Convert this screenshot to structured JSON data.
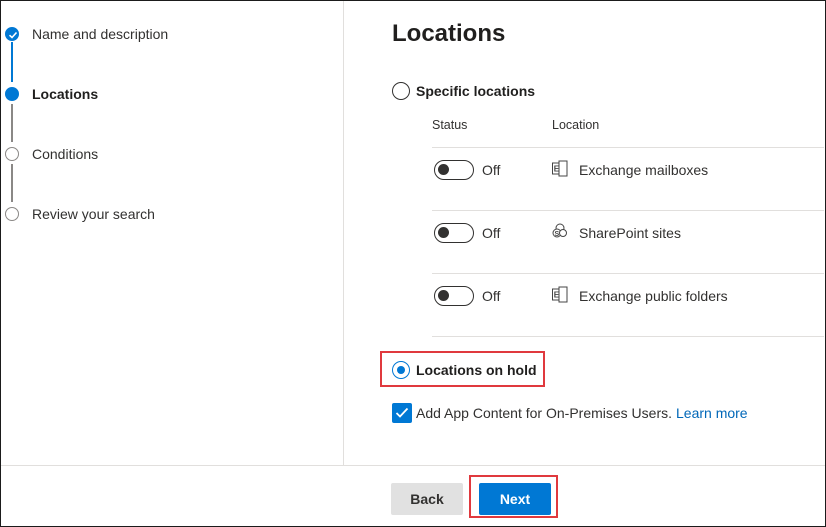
{
  "stepper": {
    "steps": [
      {
        "label": "Name and description",
        "state": "done"
      },
      {
        "label": "Locations",
        "state": "current"
      },
      {
        "label": "Conditions",
        "state": "pending"
      },
      {
        "label": "Review your search",
        "state": "pending"
      }
    ]
  },
  "main": {
    "title": "Locations",
    "specific_locations": {
      "label": "Specific locations",
      "selected": false,
      "columns": {
        "status": "Status",
        "location": "Location"
      },
      "rows": [
        {
          "status": "Off",
          "location": "Exchange mailboxes",
          "icon": "exchange-icon"
        },
        {
          "status": "Off",
          "location": "SharePoint sites",
          "icon": "sharepoint-icon"
        },
        {
          "status": "Off",
          "location": "Exchange public folders",
          "icon": "exchange-icon"
        }
      ]
    },
    "locations_on_hold": {
      "label": "Locations on hold",
      "selected": true
    },
    "app_content": {
      "label": "Add App Content for On-Premises Users.",
      "link": "Learn more",
      "checked": true
    }
  },
  "footer": {
    "back_label": "Back",
    "next_label": "Next"
  },
  "colors": {
    "accent": "#0078d4",
    "highlight": "#e0393e",
    "link": "#0067b8"
  }
}
